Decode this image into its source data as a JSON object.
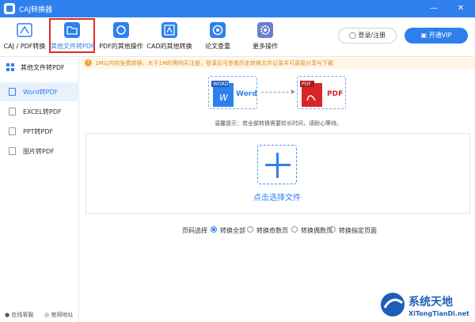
{
  "app": {
    "title": "CAJ转换器"
  },
  "window": {
    "minimize": "—",
    "close": "✕"
  },
  "toolbar": {
    "tools": [
      {
        "label": "CAJ / PDF转换",
        "icon": "caj-pdf-icon",
        "color": "#e0e0e0"
      },
      {
        "label": "其他文件转PDF",
        "icon": "folder-icon",
        "color": "#2f80ed"
      },
      {
        "label": "PDF的其他操作",
        "icon": "refresh-icon",
        "color": "#2f80ed"
      },
      {
        "label": "CAD的其他转换",
        "icon": "cad-icon",
        "color": "#2f80ed"
      },
      {
        "label": "论文查重",
        "icon": "at-icon",
        "color": "#2f80ed"
      },
      {
        "label": "更多操作",
        "icon": "gear-icon",
        "color": "#6b7fd1"
      }
    ],
    "login_label": "登录/注册",
    "vip_label": "开通VIP"
  },
  "sidebar": {
    "header": "其他文件转PDF",
    "items": [
      {
        "label": "Word转PDF"
      },
      {
        "label": "EXCEL转PDF"
      },
      {
        "label": "PPT转PDF"
      },
      {
        "label": "图片转PDF"
      }
    ],
    "online_service": "在线客服",
    "official_site": "官网地址"
  },
  "notice": {
    "text": "1M以内的免费转换，大于1M的需购买注册，登录后可查看历史转换文件记录并可直接分享与下载"
  },
  "conversion": {
    "from_tag": "WORD",
    "from_letter": "W",
    "from_label": "Word",
    "to_tag": "PDF",
    "to_label": "PDF"
  },
  "hint": "温馨提示：若全部转换需要较长时间，请耐心等待。",
  "dropzone": {
    "label": "点击选择文件"
  },
  "page_select": {
    "label": "页码选择",
    "options": [
      "转换全部",
      "转换奇数页",
      "转换偶数页",
      "转换指定页面"
    ],
    "selected": "转换全部"
  },
  "watermark": {
    "main": "系统天地",
    "sub": "XiTongTianDi.net"
  },
  "colors": {
    "accent": "#2f80ed",
    "notice": "#e08a20",
    "pdf_red": "#d9252a"
  }
}
